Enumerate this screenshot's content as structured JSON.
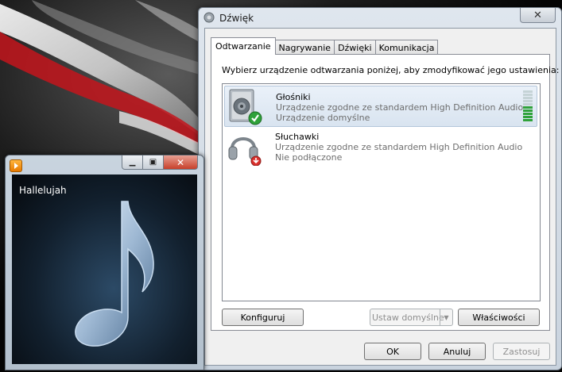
{
  "sound_dialog": {
    "title": "Dźwięk",
    "close_glyph": "✕",
    "tabs": [
      {
        "label": "Odtwarzanie",
        "active": true
      },
      {
        "label": "Nagrywanie",
        "active": false
      },
      {
        "label": "Dźwięki",
        "active": false
      },
      {
        "label": "Komunikacja",
        "active": false
      }
    ],
    "instruction": "Wybierz urządzenie odtwarzania poniżej, aby zmodyfikować jego ustawienia:",
    "devices": [
      {
        "name": "Głośniki",
        "description": "Urządzenie zgodne ze standardem High Definition Audio",
        "status": "Urządzenie domyślne",
        "icon": "speaker-icon",
        "badge": "default-check-icon",
        "selected": true,
        "level_bars_lit": 5,
        "level_bars_total": 10
      },
      {
        "name": "Słuchawki",
        "description": "Urządzenie zgodne ze standardem High Definition Audio",
        "status": "Nie podłączone",
        "icon": "headphones-icon",
        "badge": "unplugged-icon",
        "selected": false
      }
    ],
    "buttons": {
      "configure": "Konfiguruj",
      "set_default": "Ustaw domyślne",
      "properties": "Właściwości",
      "ok": "OK",
      "cancel": "Anuluj",
      "apply": "Zastosuj"
    },
    "colors": {
      "level_on": "#2fa23a",
      "level_off": "#c5d3d6",
      "check": "#2fa23a",
      "unplugged": "#d9302c"
    }
  },
  "media_player": {
    "track_title": "Hallelujah",
    "minimize_glyph": "▁",
    "maximize_glyph": "▣",
    "close_glyph": "✕",
    "art_icon": "music-note-icon"
  }
}
